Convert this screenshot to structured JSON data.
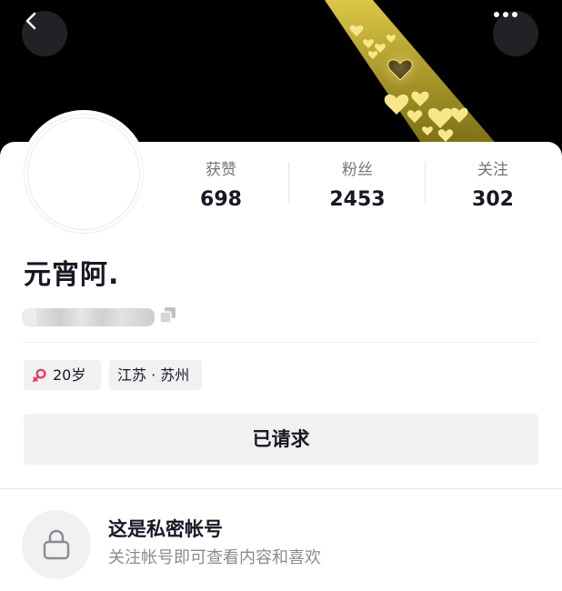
{
  "header": {
    "back_icon": "chevron-left-icon",
    "more_icon": "more-horizontal-icon",
    "cover_description": ""
  },
  "stats": [
    {
      "label": "获赞",
      "value": "698"
    },
    {
      "label": "粉丝",
      "value": "2453"
    },
    {
      "label": "关注",
      "value": "302"
    }
  ],
  "profile": {
    "nickname": "元宵阿.",
    "copy_icon": "copy-icon"
  },
  "tags": {
    "gender_icon": "female-icon",
    "age": "20岁",
    "location": "江苏 · 苏州"
  },
  "actions": {
    "request_label": "已请求"
  },
  "private_notice": {
    "icon": "lock-icon",
    "title": "这是私密帐号",
    "subtitle": "关注帐号即可查看内容和喜欢"
  },
  "colors": {
    "female_pink": "#fe2c55",
    "spotlight": "#c8b228",
    "background": "#ffffff",
    "chip": "#f1f1f2"
  }
}
